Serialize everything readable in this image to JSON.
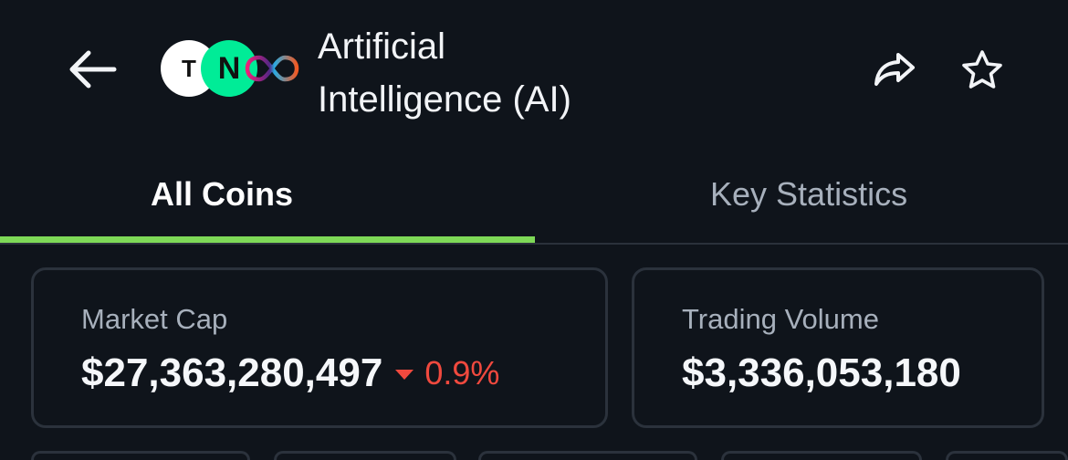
{
  "header": {
    "title_line1": "Artificial",
    "title_line2": "Intelligence (AI)",
    "logos": [
      {
        "name": "tao-logo",
        "letter": "T",
        "bg": "#ffffff"
      },
      {
        "name": "near-logo",
        "letter": "N",
        "bg": "#00ec97"
      },
      {
        "name": "icp-logo",
        "icon": "infinity-icon"
      }
    ],
    "back_icon": "arrow-left-icon",
    "share_icon": "share-icon",
    "favorite_icon": "star-icon"
  },
  "tabs": [
    {
      "label": "All Coins",
      "active": true
    },
    {
      "label": "Key Statistics",
      "active": false
    }
  ],
  "stats": {
    "market_cap": {
      "label": "Market Cap",
      "value": "$27,363,280,497",
      "change": "0.9%",
      "direction": "down"
    },
    "trading_volume": {
      "label": "Trading Volume",
      "value": "$3,336,053,180"
    }
  },
  "colors": {
    "background": "#0f141b",
    "accent": "#7ed957",
    "negative": "#f0493e",
    "muted_text": "#a7b0bc"
  }
}
